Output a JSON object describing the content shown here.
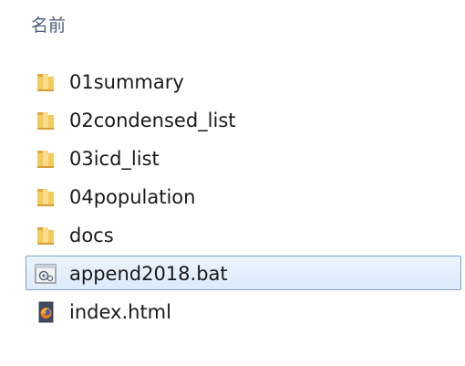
{
  "header": {
    "name_column": "名前"
  },
  "files": [
    {
      "name": "01summary",
      "icon": "folder-icon",
      "selected": false
    },
    {
      "name": "02condensed_list",
      "icon": "folder-icon",
      "selected": false
    },
    {
      "name": "03icd_list",
      "icon": "folder-icon",
      "selected": false
    },
    {
      "name": "04population",
      "icon": "folder-icon",
      "selected": false
    },
    {
      "name": "docs",
      "icon": "folder-icon",
      "selected": false
    },
    {
      "name": "append2018.bat",
      "icon": "batch-file-icon",
      "selected": true
    },
    {
      "name": "index.html",
      "icon": "firefox-html-icon",
      "selected": false
    }
  ],
  "colors": {
    "folder": "#f2c35a",
    "selection_border": "#7da2ce",
    "selection_fill": "#dceafb",
    "header_text": "#4c607a"
  }
}
